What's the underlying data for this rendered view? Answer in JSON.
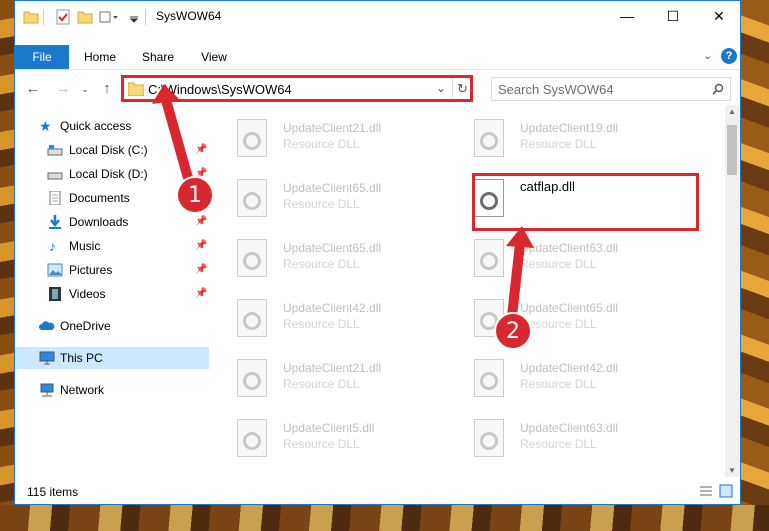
{
  "window": {
    "title": "SysWOW64"
  },
  "ribbon": {
    "tabs": [
      "File",
      "Home",
      "Share",
      "View"
    ]
  },
  "address": {
    "path": "C:\\Windows\\SysWOW64"
  },
  "search": {
    "placeholder": "Search SysWOW64"
  },
  "sidebar": {
    "items": [
      {
        "label": "Quick access",
        "icon": "star-icon"
      },
      {
        "label": "Local Disk (C:)",
        "icon": "drive-icon",
        "pinned": true
      },
      {
        "label": "Local Disk (D:)",
        "icon": "drive-icon",
        "pinned": true
      },
      {
        "label": "Documents",
        "icon": "document-icon",
        "pinned": true
      },
      {
        "label": "Downloads",
        "icon": "download-icon",
        "pinned": true
      },
      {
        "label": "Music",
        "icon": "music-icon",
        "pinned": true
      },
      {
        "label": "Pictures",
        "icon": "picture-icon",
        "pinned": true
      },
      {
        "label": "Videos",
        "icon": "video-icon",
        "pinned": true
      },
      {
        "label": "OneDrive",
        "icon": "cloud-icon"
      },
      {
        "label": "This PC",
        "icon": "computer-icon",
        "selected": true
      },
      {
        "label": "Network",
        "icon": "network-icon"
      }
    ]
  },
  "files": {
    "left": [
      {
        "name": "UpdateClient21.dll",
        "desc": "Resource DLL"
      },
      {
        "name": "UpdateClient65.dll",
        "desc": "Resource DLL"
      },
      {
        "name": "UpdateClient65.dll",
        "desc": "Resource DLL"
      },
      {
        "name": "UpdateClient42.dll",
        "desc": "Resource DLL"
      },
      {
        "name": "UpdateClient21.dll",
        "desc": "Resource DLL"
      },
      {
        "name": "UpdateClient5.dll",
        "desc": "Resource DLL"
      }
    ],
    "right": [
      {
        "name": "UpdateClient19.dll",
        "desc": "Resource DLL"
      },
      {
        "name": "catflap.dll",
        "desc": ""
      },
      {
        "name": "UpdateClient63.dll",
        "desc": "Resource DLL"
      },
      {
        "name": "UpdateClient65.dll",
        "desc": "Resource DLL"
      },
      {
        "name": "UpdateClient42.dll",
        "desc": "Resource DLL"
      },
      {
        "name": "UpdateClient63.dll",
        "desc": "Resource DLL"
      }
    ]
  },
  "status": {
    "count": "115 items"
  },
  "annotations": {
    "step1": "1",
    "step2": "2",
    "color": "#d8272e"
  }
}
